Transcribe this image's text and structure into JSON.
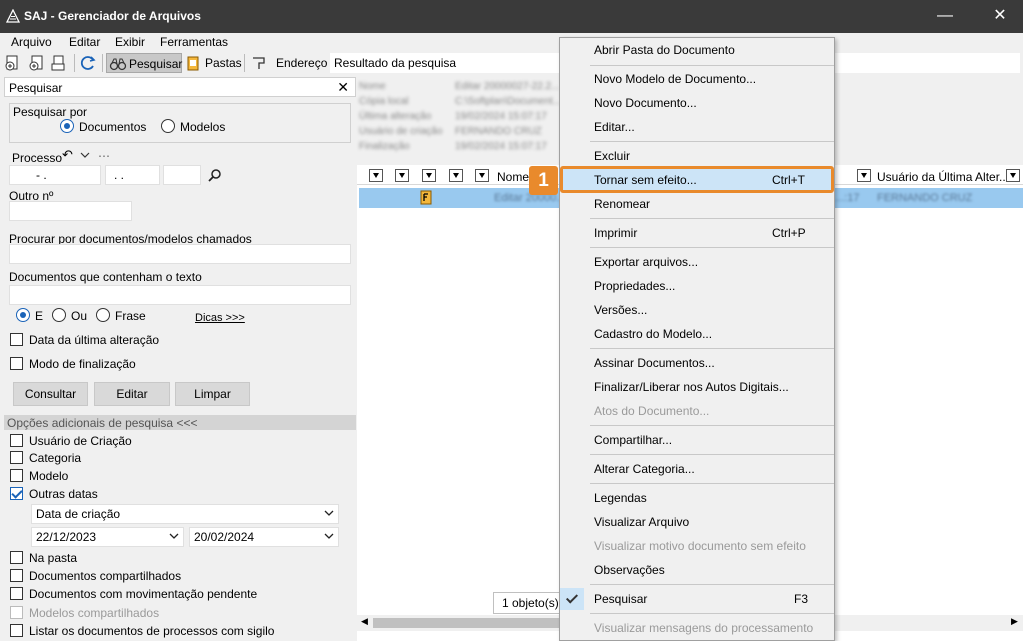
{
  "window": {
    "title": "SAJ - Gerenciador de Arquivos"
  },
  "menu": [
    "Arquivo",
    "Editar",
    "Exibir",
    "Ferramentas"
  ],
  "toolbar": {
    "search_label": "Pesquisar",
    "folders_label": "Pastas",
    "address_label": "Endereço",
    "address_value": "Resultado da pesquisa"
  },
  "search_panel": {
    "title": "Pesquisar",
    "search_by_label": "Pesquisar por",
    "search_by_options": [
      "Documentos",
      "Modelos"
    ],
    "process_label": "Processo",
    "process_mask_1": "- .",
    "process_mask_2": ". .",
    "other_number_label": "Outro nº",
    "search_named_label": "Procurar por documentos/modelos chamados",
    "contains_text_label": "Documentos que contenham o texto",
    "text_logic": [
      "E",
      "Ou",
      "Frase"
    ],
    "tips_link": "Dicas >>>",
    "last_change_label": "Data da última alteração",
    "finalization_label": "Modo de finalização",
    "buttons": {
      "consultar": "Consultar",
      "editar": "Editar",
      "limpar": "Limpar"
    },
    "additional_header": "Opções adicionais de pesquisa <<<",
    "options": {
      "usuario_criacao": "Usuário de Criação",
      "categoria": "Categoria",
      "modelo": "Modelo",
      "outras_datas": "Outras datas",
      "date_type": "Data de criação",
      "date_from": "22/12/2023",
      "date_to": "20/02/2024",
      "na_pasta": "Na pasta",
      "compartilhados": "Documentos compartilhados",
      "mov_pendente": "Documentos com movimentação pendente",
      "modelos_compartilhados": "Modelos compartilhados",
      "sigilo": "Listar os documentos de processos com sigilo"
    }
  },
  "results": {
    "col_name": "Nome",
    "col_last_user": "Usuário da Última Alter...",
    "status": "1 objeto(s)",
    "props": [
      [
        "Nome",
        "Editar 20000027-22.2..."
      ],
      [
        "Cópia local",
        "C:\\Softplan\\Document..."
      ],
      [
        "Última alteração",
        "19/02/2024 15:07:17"
      ],
      [
        "Usuário de criação",
        "FERNANDO CRUZ"
      ],
      [
        "Finalização",
        "19/02/2024 15:07:17"
      ]
    ],
    "row_name": "Editar 20000...",
    "row_date": "...:17",
    "row_user": "FERNANDO CRUZ"
  },
  "context_menu": [
    {
      "label": "Abrir Pasta do Documento",
      "shortcut": ""
    },
    {
      "label": "Novo Modelo de Documento...",
      "shortcut": ""
    },
    {
      "label": "Novo Documento...",
      "shortcut": ""
    },
    {
      "label": "Editar...",
      "shortcut": ""
    },
    {
      "label": "Excluir",
      "shortcut": ""
    },
    {
      "label": "Tornar sem efeito...",
      "shortcut": "Ctrl+T"
    },
    {
      "label": "Renomear",
      "shortcut": ""
    },
    {
      "label": "Imprimir",
      "shortcut": "Ctrl+P"
    },
    {
      "label": "Exportar arquivos...",
      "shortcut": ""
    },
    {
      "label": "Propriedades...",
      "shortcut": ""
    },
    {
      "label": "Versões...",
      "shortcut": ""
    },
    {
      "label": "Cadastro do Modelo...",
      "shortcut": ""
    },
    {
      "label": "Assinar Documentos...",
      "shortcut": ""
    },
    {
      "label": "Finalizar/Liberar nos Autos Digitais...",
      "shortcut": ""
    },
    {
      "label": "Atos do Documento...",
      "shortcut": ""
    },
    {
      "label": "Compartilhar...",
      "shortcut": ""
    },
    {
      "label": "Alterar Categoria...",
      "shortcut": ""
    },
    {
      "label": "Legendas",
      "shortcut": ""
    },
    {
      "label": "Visualizar Arquivo",
      "shortcut": ""
    },
    {
      "label": "Visualizar motivo documento sem efeito",
      "shortcut": ""
    },
    {
      "label": "Observações",
      "shortcut": ""
    },
    {
      "label": "Pesquisar",
      "shortcut": "F3"
    },
    {
      "label": "Visualizar mensagens do processamento",
      "shortcut": ""
    }
  ],
  "callout": {
    "number": "1",
    "color": "#e98a2c"
  },
  "colors": {
    "titlebar": "#3a3a3a",
    "selection": "#99c9ef",
    "accent": "#1a63b8"
  }
}
